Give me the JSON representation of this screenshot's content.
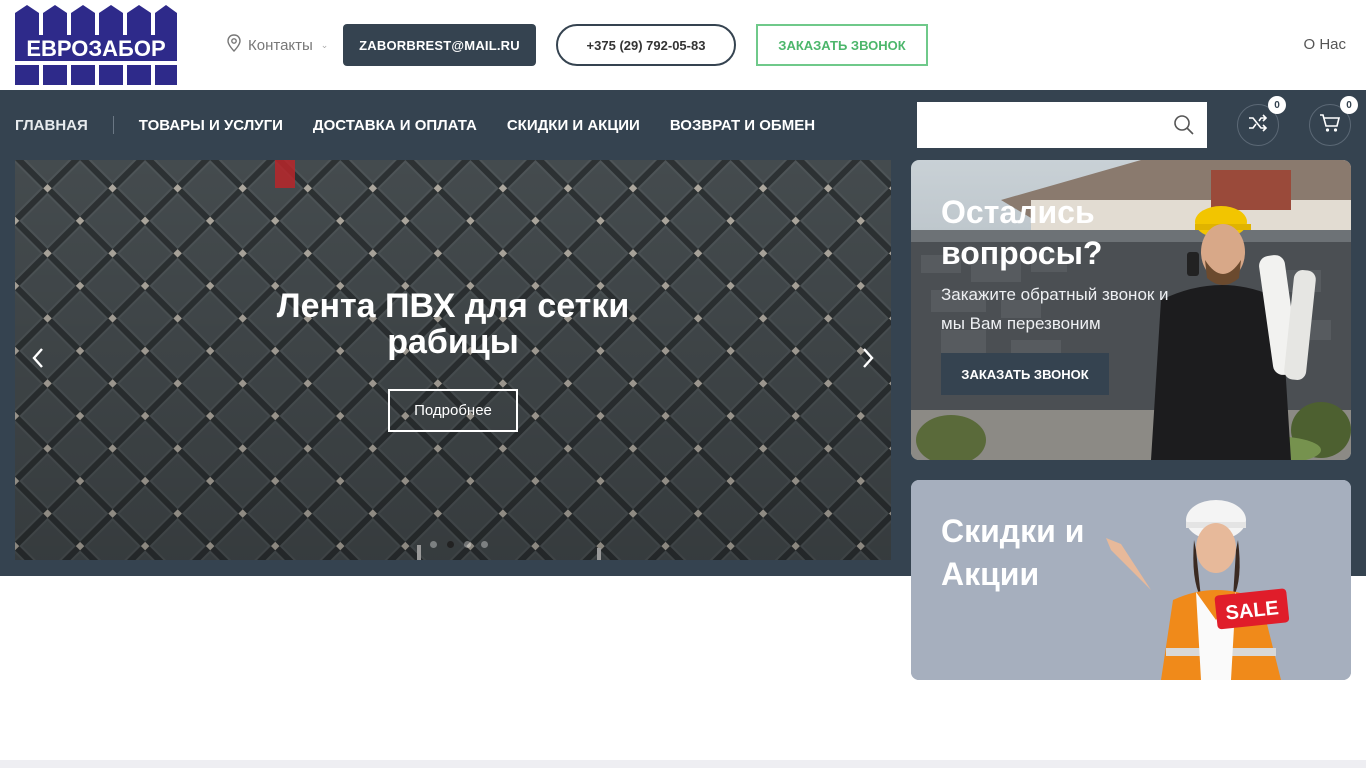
{
  "brand": {
    "logo_text": "ЕВРОЗАБОР",
    "color": "#2e2a8a"
  },
  "header": {
    "contacts_label": "Контакты",
    "email_button": "ZABORBREST@MAIL.RU",
    "phone_button": "+375 (29) 792-05-83",
    "call_button": "ЗАКАЗАТЬ ЗВОНОК",
    "about_link": "О Нас"
  },
  "nav": {
    "items": [
      {
        "label": "ГЛАВНАЯ"
      },
      {
        "label": "ТОВАРЫ И УСЛУГИ"
      },
      {
        "label": "ДОСТАВКА И ОПЛАТА"
      },
      {
        "label": "СКИДКИ И АКЦИИ"
      },
      {
        "label": "ВОЗВРАТ И ОБМЕН"
      }
    ],
    "search_placeholder": "",
    "compare_count": "0",
    "cart_count": "0"
  },
  "slider": {
    "title_line1": "Лента ПВХ для сетки",
    "title_line2": "рабицы",
    "button": "Подробнее",
    "active_index": 1
  },
  "banner_callback": {
    "title": "Остались вопросы?",
    "text": "Закажите обратный звонок и мы Вам перезвоним",
    "button": "ЗАКАЗАТЬ ЗВОНОК"
  },
  "banner_sales": {
    "title": "Скидки и Акции",
    "sale_tag": "SALE"
  },
  "colors": {
    "dark": "#354350",
    "accent_green": "#4cb66b",
    "white": "#ffffff"
  }
}
